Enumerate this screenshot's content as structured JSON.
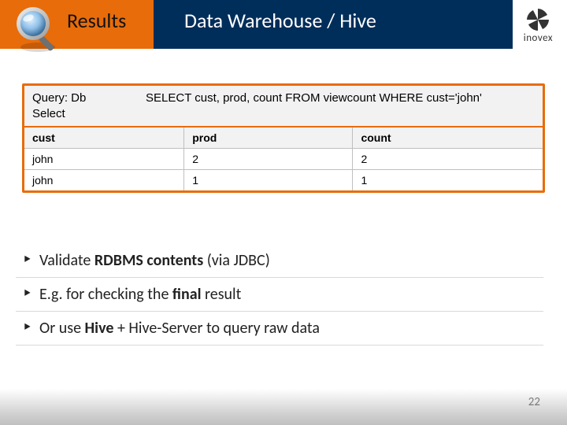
{
  "header": {
    "results_label": "Results",
    "topic_label": "Data Warehouse / Hive",
    "logo_text": "inovex"
  },
  "query_panel": {
    "label_line1": "Query: Db",
    "label_line2": "Select",
    "sql": "SELECT cust, prod, count FROM viewcount WHERE cust='john'"
  },
  "result_table": {
    "headers": [
      "cust",
      "prod",
      "count"
    ],
    "rows": [
      [
        "john",
        "2",
        "2"
      ],
      [
        "john",
        "1",
        "1"
      ]
    ]
  },
  "bullets": {
    "b1_pre": "Validate ",
    "b1_bold": "RDBMS contents",
    "b1_post": " (via JDBC)",
    "b2_pre": "E.g. for checking the ",
    "b2_bold": "final",
    "b2_post": " result",
    "b3_pre": "Or use ",
    "b3_bold": "Hive",
    "b3_post": " + Hive-Server to query raw data"
  },
  "page_number": "22",
  "colors": {
    "orange": "#e86c0a",
    "navy": "#002e5a"
  }
}
